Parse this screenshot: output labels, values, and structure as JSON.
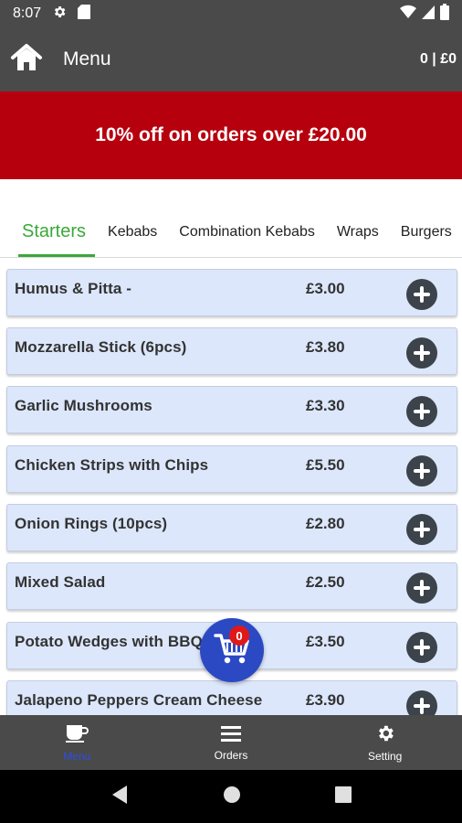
{
  "status_bar": {
    "time": "8:07"
  },
  "app_bar": {
    "title": "Menu",
    "cart_summary": "0 | £0"
  },
  "promo": {
    "text": "10% off on orders over £20.00"
  },
  "tabs": [
    {
      "label": "Starters",
      "active": true
    },
    {
      "label": "Kebabs",
      "active": false
    },
    {
      "label": "Combination Kebabs",
      "active": false
    },
    {
      "label": "Wraps",
      "active": false
    },
    {
      "label": "Burgers",
      "active": false
    }
  ],
  "items": [
    {
      "name": "Humus & Pitta -",
      "price": "£3.00"
    },
    {
      "name": "Mozzarella Stick (6pcs)",
      "price": "£3.80"
    },
    {
      "name": "Garlic Mushrooms",
      "price": "£3.30"
    },
    {
      "name": "Chicken Strips with Chips",
      "price": "£5.50"
    },
    {
      "name": "Onion Rings (10pcs)",
      "price": "£2.80"
    },
    {
      "name": "Mixed Salad",
      "price": "£2.50"
    },
    {
      "name": "Potato Wedges with BBQ",
      "price": "£3.50"
    },
    {
      "name": "Jalapeno Peppers Cream Cheese",
      "price": "£3.90"
    }
  ],
  "cart_fab": {
    "count": "0",
    "icon": "shopping-cart-icon"
  },
  "bottom_nav": [
    {
      "label": "Menu",
      "icon": "coffee-cup-icon",
      "active": true
    },
    {
      "label": "Orders",
      "icon": "list-icon",
      "active": false
    },
    {
      "label": "Setting",
      "icon": "gear-icon",
      "active": false
    }
  ],
  "colors": {
    "app_bar": "#4a4a4a",
    "promo": "#b7000e",
    "active_tab": "#3aa83a",
    "item_bg": "#dce7fb",
    "fab": "#2c49c4",
    "badge": "#e01818",
    "nav_active": "#2f4fe0"
  }
}
